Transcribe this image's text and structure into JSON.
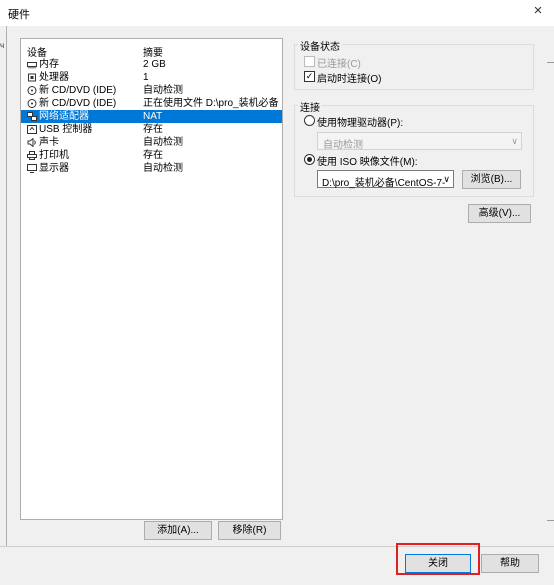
{
  "window": {
    "title": "硬件",
    "close_icon": "×"
  },
  "device_list": {
    "col_device": "设备",
    "col_summary": "摘要",
    "selected_index": 4,
    "rows": [
      {
        "icon": "memory-icon",
        "name": "内存",
        "summary": "2 GB"
      },
      {
        "icon": "cpu-icon",
        "name": "处理器",
        "summary": "1"
      },
      {
        "icon": "cdrom-icon",
        "name": "新 CD/DVD (IDE)",
        "summary": "自动检测"
      },
      {
        "icon": "cdrom-icon",
        "name": "新 CD/DVD (IDE)",
        "summary": "正在使用文件 D:\\pro_装机必备..."
      },
      {
        "icon": "network-icon",
        "name": "网络适配器",
        "summary": "NAT"
      },
      {
        "icon": "usb-icon",
        "name": "USB 控制器",
        "summary": "存在"
      },
      {
        "icon": "sound-icon",
        "name": "声卡",
        "summary": "自动检测"
      },
      {
        "icon": "printer-icon",
        "name": "打印机",
        "summary": "存在"
      },
      {
        "icon": "display-icon",
        "name": "显示器",
        "summary": "自动检测"
      }
    ]
  },
  "buttons": {
    "add": "添加(A)...",
    "remove": "移除(R)",
    "browse": "浏览(B)...",
    "advanced": "高级(V)...",
    "close": "关闭",
    "help": "帮助"
  },
  "device_status": {
    "title": "设备状态",
    "connected_label": "已连接(C)",
    "connected_checked": false,
    "connect_at_poweron_label": "启动时连接(O)",
    "connect_at_poweron_checked": true
  },
  "connection": {
    "title": "连接",
    "physical_label": "使用物理驱动器(P):",
    "physical_value": "自动检测",
    "iso_label": "使用 ISO 映像文件(M):",
    "iso_value": "D:\\pro_装机必备\\CentOS-7-",
    "selected": "iso"
  }
}
